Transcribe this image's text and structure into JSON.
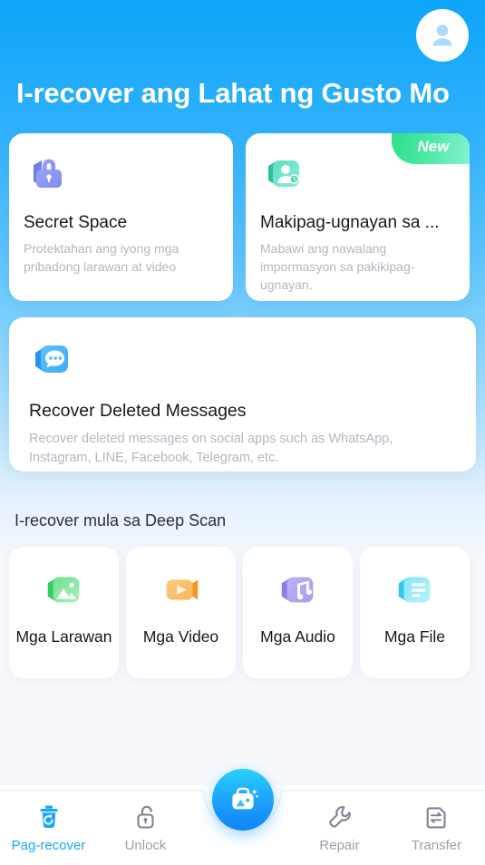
{
  "header": {
    "title": "I-recover ang Lahat ng Gusto Mo",
    "avatar_icon": "user-avatar-icon"
  },
  "feature_cards": [
    {
      "id": "secret-space",
      "title": "Secret Space",
      "desc": "Protektahan ang iyong mga pribadong larawan at video",
      "icon": "lock-icon",
      "color": "#8f9bf5",
      "badge": null
    },
    {
      "id": "contact-recovery",
      "title": "Makipag-ugnayan sa ...",
      "desc": "Mabawi ang nawalang impormasyon sa pakikipag-ugnayan.",
      "icon": "contact-clock-icon",
      "color": "#4fd6b8",
      "badge": "New"
    },
    {
      "id": "recover-deleted-messages",
      "title": "Recover Deleted Messages",
      "desc": "Recover deleted messages on social apps such as WhatsApp, Instagram, LINE, Facebook, Telegram, etc.",
      "icon": "chat-bubble-icon",
      "color": "#49b6fb",
      "badge": null
    }
  ],
  "deep_scan": {
    "section_title": "I-recover mula sa Deep Scan",
    "tiles": [
      {
        "id": "photos",
        "label": "Mga Larawan",
        "icon": "photo-icon",
        "color": "#5fd77f"
      },
      {
        "id": "videos",
        "label": "Mga Video",
        "icon": "video-icon",
        "color": "#f9b961"
      },
      {
        "id": "audio",
        "label": "Mga Audio",
        "icon": "music-icon",
        "color": "#b3a7f2"
      },
      {
        "id": "files",
        "label": "Mga File",
        "icon": "document-icon",
        "color": "#6ddcf7"
      }
    ]
  },
  "bottom_nav": {
    "items": [
      {
        "id": "recover",
        "label": "Pag-recover",
        "icon": "trash-restore-icon",
        "active": true
      },
      {
        "id": "unlock",
        "label": "Unlock",
        "icon": "padlock-open-icon",
        "active": false
      },
      {
        "id": "repair",
        "label": "Repair",
        "icon": "wrench-icon",
        "active": false
      },
      {
        "id": "transfer",
        "label": "Transfer",
        "icon": "transfer-icon",
        "active": false
      }
    ],
    "fab": {
      "id": "toolkit",
      "icon": "toolbox-sparkle-icon"
    },
    "active_color": "#1aa6fb",
    "inactive_color": "#9aa0ab"
  }
}
